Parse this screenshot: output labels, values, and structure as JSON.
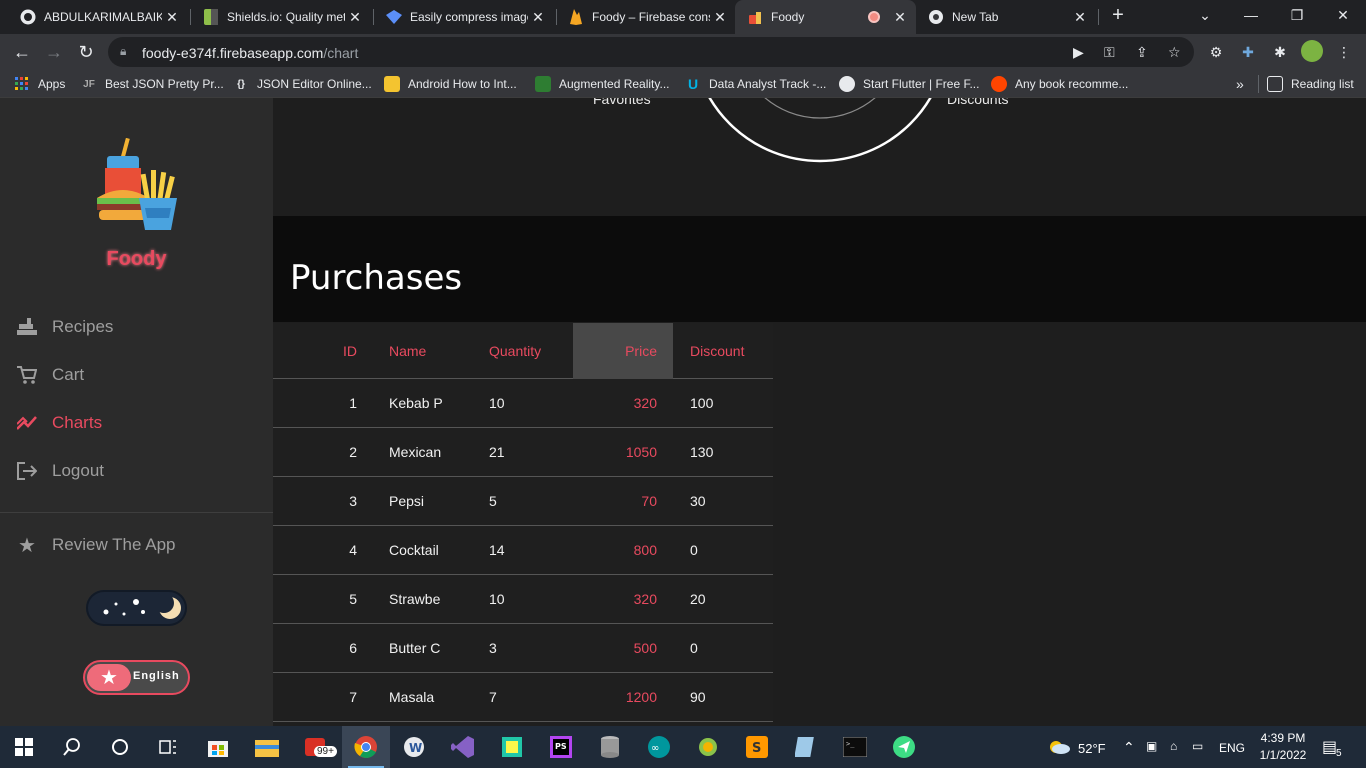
{
  "browser": {
    "tabs": [
      {
        "title": "ABDULKARIMALBAIK/",
        "icon": "github-icon",
        "active": false
      },
      {
        "title": "Shields.io: Quality met",
        "icon": "shields-icon",
        "active": false
      },
      {
        "title": "Easily compress image",
        "icon": "compress-icon",
        "active": false
      },
      {
        "title": "Foody – Firebase cons",
        "icon": "firebase-icon",
        "active": false
      },
      {
        "title": "Foody",
        "icon": "foody-icon",
        "active": true
      },
      {
        "title": "New Tab",
        "icon": "chrome-icon",
        "active": false
      }
    ],
    "url_domain": "foody-e374f.firebaseapp.com",
    "url_path": "/chart",
    "bookmarks": [
      {
        "label": "Apps",
        "icon": "apps-grid-icon"
      },
      {
        "label": "Best JSON Pretty Pr...",
        "icon": "jf-icon"
      },
      {
        "label": "JSON Editor Online...",
        "icon": "braces-icon"
      },
      {
        "label": "Android How to Int...",
        "icon": "android-icon"
      },
      {
        "label": "Augmented Reality...",
        "icon": "ar-icon"
      },
      {
        "label": "Data Analyst Track -...",
        "icon": "udacity-icon"
      },
      {
        "label": "Start Flutter | Free F...",
        "icon": "globe-icon"
      },
      {
        "label": "Any book recomme...",
        "icon": "reddit-icon"
      }
    ],
    "reading_list": "Reading list"
  },
  "sidebar": {
    "brand": "Foody",
    "nav": [
      {
        "label": "Recipes",
        "icon": "recipes-icon",
        "active": false
      },
      {
        "label": "Cart",
        "icon": "cart-icon",
        "active": false
      },
      {
        "label": "Charts",
        "icon": "chart-line-icon",
        "active": true
      },
      {
        "label": "Logout",
        "icon": "logout-icon",
        "active": false
      }
    ],
    "review": "Review The App",
    "language": "English"
  },
  "chart": {
    "legend_left": "Favorites",
    "legend_right": "Discounts"
  },
  "purchases": {
    "title": "Purchases",
    "columns": [
      "ID",
      "Name",
      "Quantity",
      "Price",
      "Discount"
    ],
    "sorted_column": "Price",
    "rows": [
      {
        "id": "1",
        "name": "Kebab P",
        "quantity": "10",
        "price": "320",
        "discount": "100"
      },
      {
        "id": "2",
        "name": "Mexican",
        "quantity": "21",
        "price": "1050",
        "discount": "130"
      },
      {
        "id": "3",
        "name": "Pepsi",
        "quantity": "5",
        "price": "70",
        "discount": "30"
      },
      {
        "id": "4",
        "name": "Cocktail",
        "quantity": "14",
        "price": "800",
        "discount": "0"
      },
      {
        "id": "5",
        "name": "Strawbe",
        "quantity": "10",
        "price": "320",
        "discount": "20"
      },
      {
        "id": "6",
        "name": "Butter C",
        "quantity": "3",
        "price": "500",
        "discount": "0"
      },
      {
        "id": "7",
        "name": "Masala",
        "quantity": "7",
        "price": "1200",
        "discount": "90"
      }
    ]
  },
  "taskbar": {
    "badge": "99+",
    "weather": "52°F",
    "language": "ENG",
    "time": "4:39 PM",
    "date": "1/1/2022",
    "notifications": "5"
  }
}
